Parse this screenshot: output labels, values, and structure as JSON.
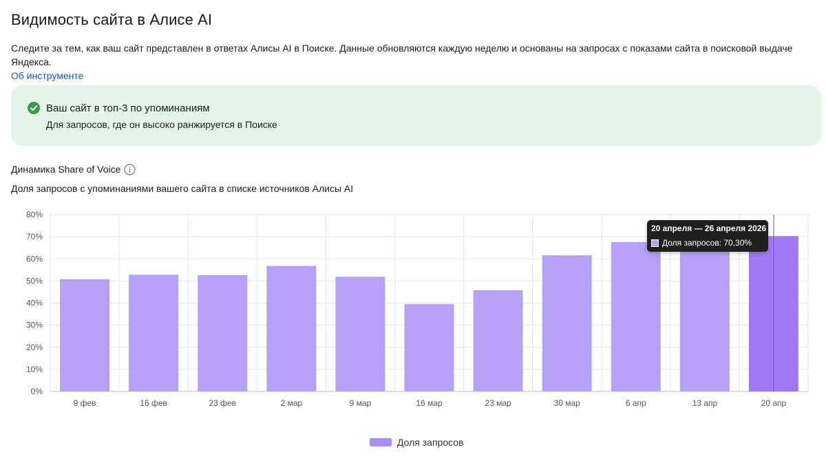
{
  "page": {
    "title": "Видимость сайта в Алисе AI",
    "intro_text": "Следите за тем, как ваш сайт представлен в ответах Алисы AI в Поиске. Данные обновляются каждую неделю и основаны на запросах с показами сайта в поисковой выдаче Яндекса.",
    "about_link": "Об инструменте"
  },
  "banner": {
    "title": "Ваш сайт в топ-3 по упоминаниям",
    "subtitle": "Для запросов, где он высоко ранжируется в Поиске",
    "icon": "check-circle-icon",
    "background": "#e4f5ea",
    "icon_color": "#3a9a4f"
  },
  "chart_header": {
    "title": "Динамика Share of Voice",
    "info_icon": "info-icon",
    "subtitle": "Доля запросов с упоминаниями вашего сайта в списке источников Алисы AI"
  },
  "chart_data": {
    "type": "bar",
    "categories": [
      "9 фев",
      "16 фев",
      "23 фев",
      "2 мар",
      "9 мар",
      "16 мар",
      "23 мар",
      "30 мар",
      "6 апр",
      "13 апр",
      "20 апр"
    ],
    "series": [
      {
        "name": "Доля запросов",
        "values": [
          50.8,
          52.8,
          52.6,
          56.8,
          51.9,
          39.5,
          45.8,
          61.6,
          67.6,
          67.0,
          70.3
        ]
      }
    ],
    "y_ticks": [
      "0%",
      "10%",
      "20%",
      "30%",
      "40%",
      "50%",
      "60%",
      "70%",
      "80%"
    ],
    "ylim": [
      0,
      80
    ],
    "grid": true,
    "legend_position": "bottom",
    "bar_color": "#b7a0f7",
    "highlight_color": "#a07af5",
    "highlight_index": 10,
    "tooltip": {
      "title": "20 апреля — 26 апреля 2026",
      "label": "Доля запросов: 70,30%"
    }
  }
}
